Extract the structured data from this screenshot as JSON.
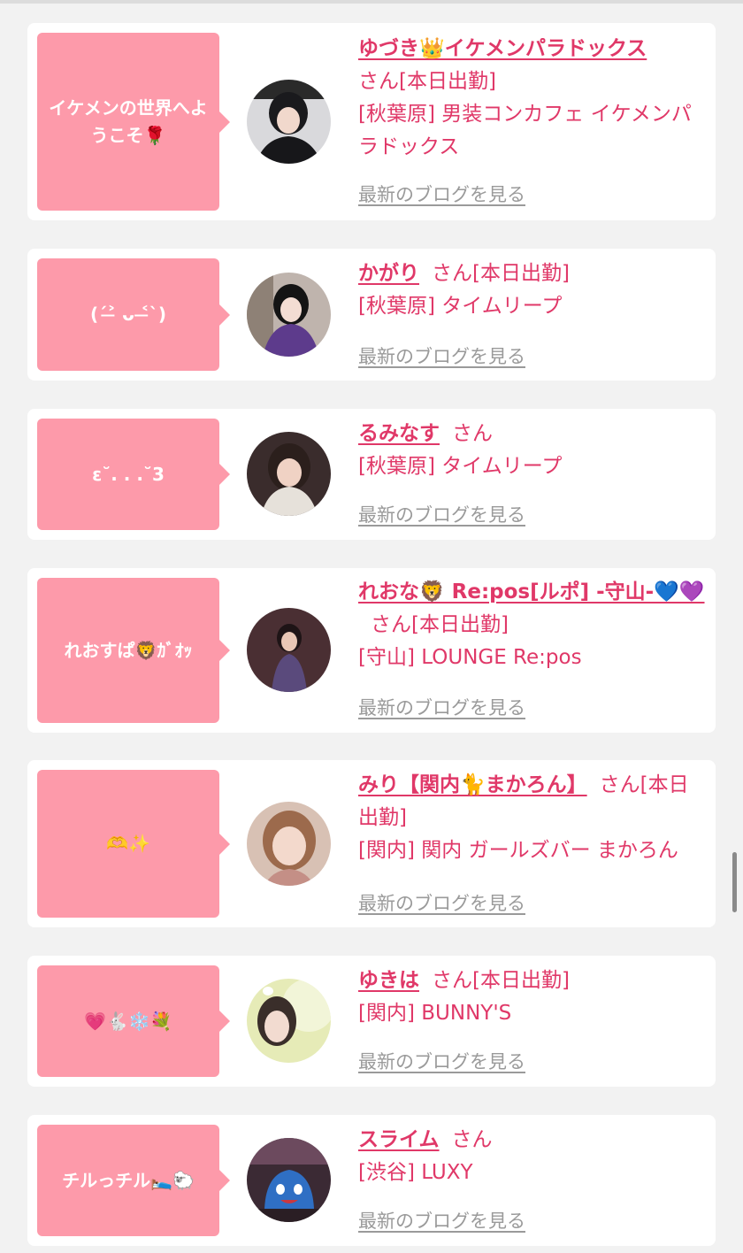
{
  "blog_link_label": "最新のブログを見る",
  "san_label": "さん",
  "attendance_label": "[本日出勤]",
  "colors": {
    "bubble": "#fd9aaa",
    "accent_text": "#e03868",
    "link_gray": "#9a9a9a",
    "background": "#f2f2f2",
    "card": "#ffffff"
  },
  "cards": [
    {
      "bubble": "イケメンの世界へようこそ🌹",
      "name": "ゆづき👑イケメンパラドックス",
      "san": "さん[本日出勤]",
      "shop": "[秋葉原] 男装コンカフェ イケメンパラドックス",
      "avatar_icon": "portrait-photo"
    },
    {
      "bubble": "(ˊ˃̶ ᴗ ˂̶ˋ)",
      "name": "かがり",
      "san": "さん[本日出勤]",
      "shop": "[秋葉原] タイムリープ",
      "avatar_icon": "portrait-photo"
    },
    {
      "bubble": "ε˘. . .˘3",
      "name": "るみなす",
      "san": "さん",
      "shop": "[秋葉原] タイムリープ",
      "avatar_icon": "portrait-photo"
    },
    {
      "bubble": "れおすぱ🦁ｶﾞｵｯ",
      "name": "れおな🦁 Re:pos[ルポ] -守山-💙💜",
      "san": "さん[本日出勤]",
      "shop": "[守山] LOUNGE Re:pos",
      "avatar_icon": "portrait-photo"
    },
    {
      "bubble": "🫶✨",
      "name": "みり【関内🐈まかろん】",
      "san": "さん[本日出勤]",
      "shop": "[関内] 関内 ガールズバー まかろん",
      "avatar_icon": "portrait-photo"
    },
    {
      "bubble": "💗🐇❄️💐",
      "name": "ゆきは",
      "san": "さん[本日出勤]",
      "shop": "[関内] BUNNY'S",
      "avatar_icon": "portrait-photo"
    },
    {
      "bubble": "チルっチル🛌🐑",
      "name": "スライム",
      "san": "さん",
      "shop": "[渋谷] LUXY",
      "avatar_icon": "slime-photo"
    }
  ]
}
